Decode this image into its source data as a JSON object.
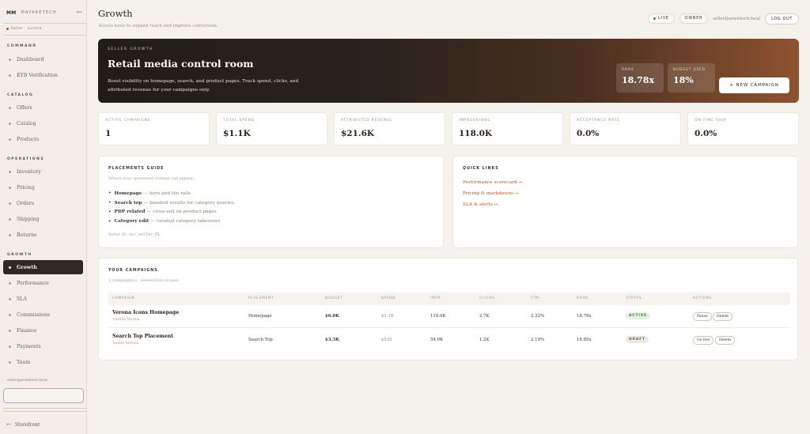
{
  "sidebar": {
    "brand_logo": "MM",
    "brand_name": "MAYAKETECH",
    "role": "Seller · aurelia",
    "sections": [
      {
        "title": "COMMAND",
        "items": [
          "Dashboard",
          "KYB Verification"
        ]
      },
      {
        "title": "CATALOG",
        "items": [
          "Offers",
          "Catalog",
          "Products"
        ]
      },
      {
        "title": "OPERATIONS",
        "items": [
          "Inventory",
          "Pricing",
          "Orders",
          "Shipping",
          "Returns"
        ]
      },
      {
        "title": "GROWTH",
        "items": [
          "Growth",
          "Performance",
          "SLA",
          "Commissions",
          "Finance",
          "Payments",
          "Team"
        ]
      }
    ],
    "active_item": "Growth",
    "email": "seller@arielstech.local",
    "footer_link": "Storefront"
  },
  "header": {
    "title": "Growth",
    "subtitle": "Access tools to expand reach and improve conversion.",
    "live_label": "LIVE",
    "role_label": "OWNER",
    "email": "seller@arielstech.local",
    "logout_label": "LOG OUT"
  },
  "hero": {
    "eyebrow": "SELLER GROWTH",
    "title": "Retail media control room",
    "text": "Boost visibility on homepage, search, and product pages. Track spend, clicks, and attributed revenue for your campaigns only.",
    "stats": [
      {
        "label": "ROAS",
        "value": "18.78x"
      },
      {
        "label": "BUDGET USED",
        "value": "18%"
      }
    ],
    "cta_label": "+ NEW CAMPAIGN"
  },
  "kpis": [
    {
      "label": "ACTIVE CAMPAIGNS",
      "value": "1"
    },
    {
      "label": "TOTAL SPEND",
      "value": "$1.1K"
    },
    {
      "label": "ATTRIBUTED REVENUE",
      "value": "$21.6K"
    },
    {
      "label": "IMPRESSIONS",
      "value": "118.0K"
    },
    {
      "label": "ACCEPTANCE RATE",
      "value": "0.0%"
    },
    {
      "label": "ON-TIME SHIP",
      "value": "0.0%"
    }
  ],
  "placements": {
    "title": "PLACEMENTS GUIDE",
    "subtitle": "Where your sponsored listings can appear.",
    "items": [
      {
        "name": "Homepage",
        "desc": "— hero and tile rails"
      },
      {
        "name": "Search top",
        "desc": "— boosted results for category queries"
      },
      {
        "name": "PDP related",
        "desc": "— cross-sell on product pages"
      },
      {
        "name": "Category edit",
        "desc": "— curated category takeovers"
      }
    ],
    "scope_label": "Seller ID:",
    "scope_value": "usr_seller_01"
  },
  "quick_links": {
    "title": "QUICK LINKS",
    "links": [
      "Performance scorecard →",
      "Pricing & markdowns →",
      "SLA & alerts →"
    ]
  },
  "campaigns": {
    "title": "YOUR CAMPAIGNS",
    "subtitle": "2 campaign(s) · seeded/live-scoped",
    "columns": [
      "CAMPAIGN",
      "PLACEMENT",
      "BUDGET",
      "SPEND",
      "IMPR.",
      "CLICKS",
      "CTR",
      "ROAS",
      "STATUS",
      "ACTIONS"
    ],
    "rows": [
      {
        "name": "Verona Icons Homepage",
        "seller": "Aurelia Verona",
        "placement": "Homepage",
        "budget": "$6.0K",
        "spend": "$1.1K",
        "impr": "118.0K",
        "clicks": "2.7K",
        "ctr": "2.32%",
        "roas": "18.78x",
        "status": "ACTIVE",
        "action1": "Pause",
        "action2": "Delete"
      },
      {
        "name": "Search Top Placement",
        "seller": "Atelier Verona",
        "placement": "Search Top",
        "budget": "$3.3K",
        "spend": "$530",
        "impr": "54.0K",
        "clicks": "1.2K",
        "ctr": "2.19%",
        "roas": "18.85x",
        "status": "DRAFT",
        "action1": "Go live",
        "action2": "Delete"
      }
    ]
  }
}
